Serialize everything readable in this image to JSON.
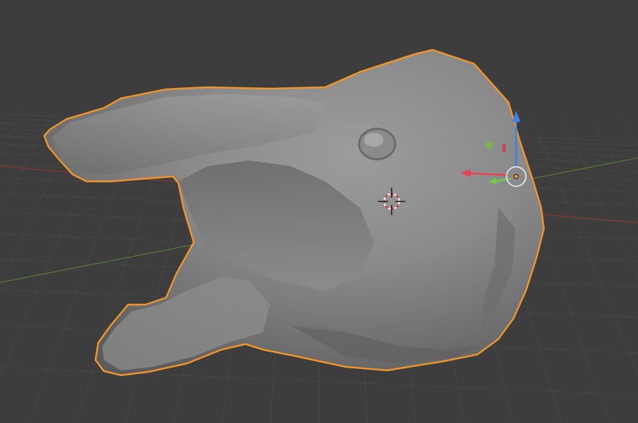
{
  "viewport": {
    "view": "3D Viewport",
    "shading": "solid",
    "background_color": "#3d3d3d",
    "grid_color": "#474747",
    "x_axis_color": "#8a3a3a",
    "y_axis_color": "#5a7a33"
  },
  "selected_object": {
    "selected": true,
    "outline_color": "#f0942c",
    "surface_color": "#8a8a8a"
  },
  "cursor_3d": {
    "visible": true,
    "ring_colors": [
      "#ffffff",
      "#d43636"
    ]
  },
  "gizmo": {
    "type": "move",
    "x_arrow_color": "#e74352",
    "y_arrow_color": "#6cd142",
    "z_arrow_color": "#3b82e6",
    "center_ring_color": "#dddddd",
    "pivot_color": "#f0942c",
    "plane_handle_colors": [
      "#7fb04a",
      "#c9454e"
    ]
  }
}
